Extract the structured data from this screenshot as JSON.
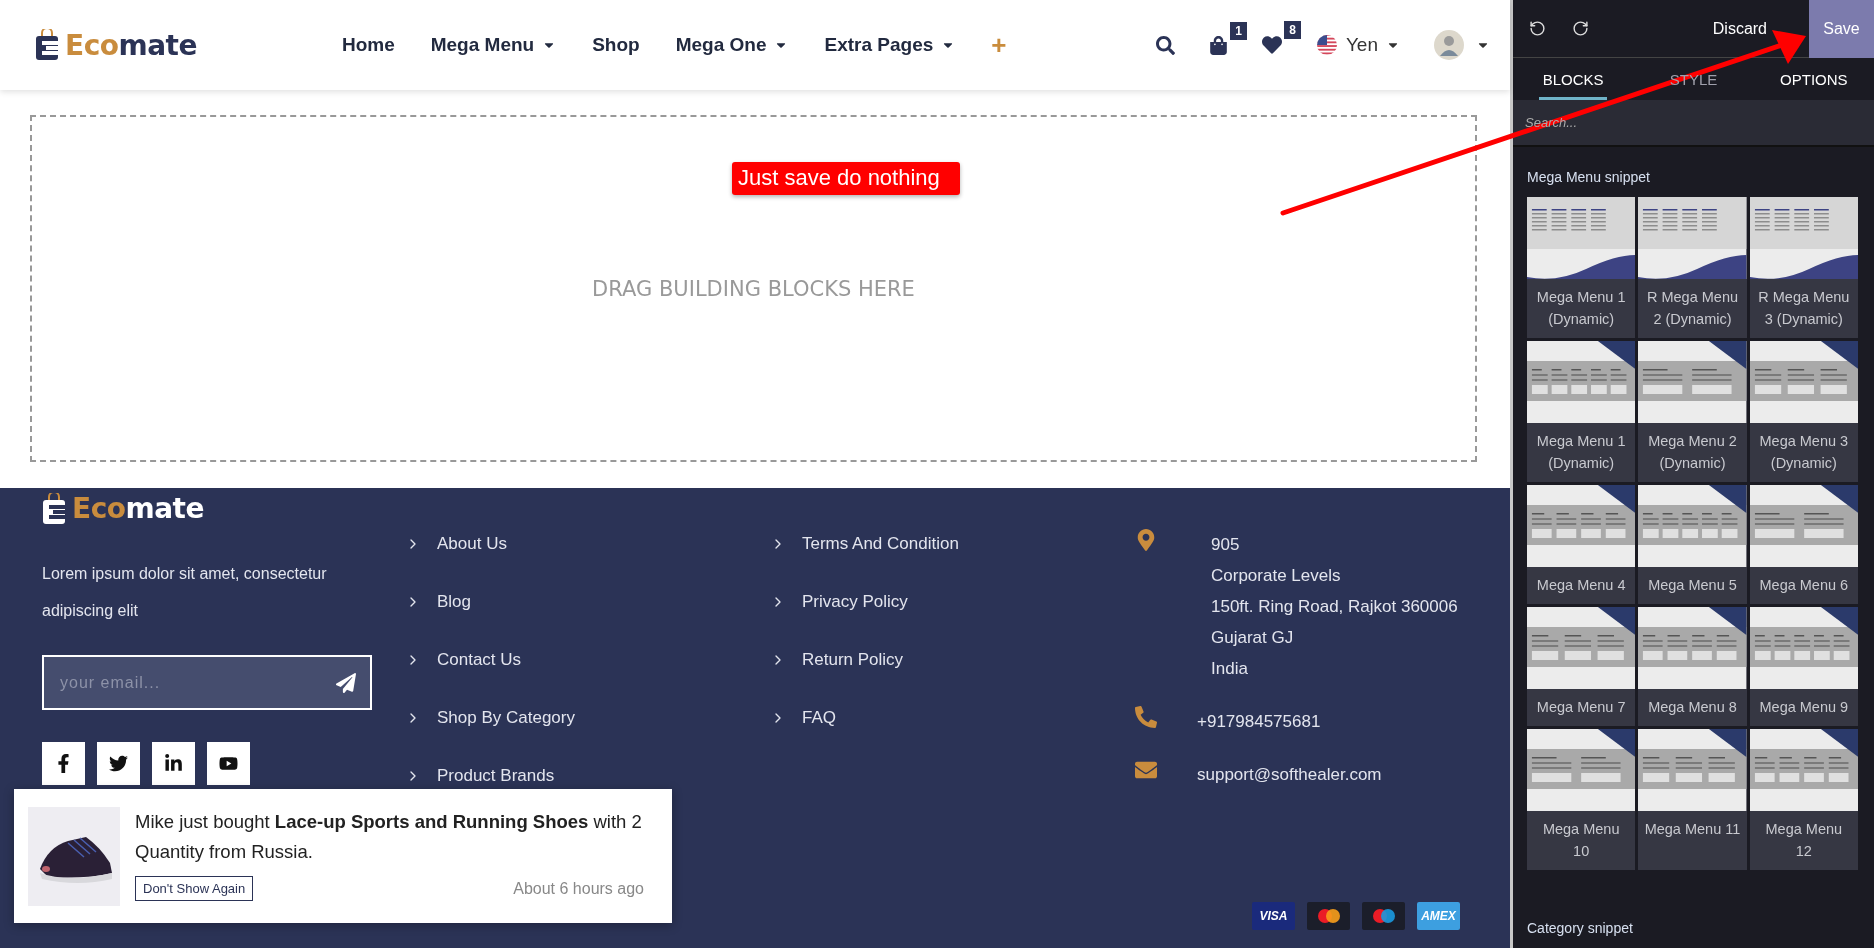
{
  "header": {
    "logo": {
      "accent": "Eco",
      "rest": "mate"
    },
    "nav": [
      {
        "label": "Home",
        "dropdown": false,
        "kind": "link"
      },
      {
        "label": "Mega Menu",
        "dropdown": true,
        "kind": "link"
      },
      {
        "label": "Shop",
        "dropdown": false,
        "kind": "link"
      },
      {
        "label": "Mega One",
        "dropdown": true,
        "kind": "link"
      },
      {
        "label": "Extra Pages",
        "dropdown": true,
        "kind": "link"
      },
      {
        "label": "+",
        "dropdown": false,
        "kind": "plus"
      }
    ],
    "cart_count": "1",
    "wishlist_count": "8",
    "currency": "Yen"
  },
  "editor_canvas": {
    "note": "Just save do nothing",
    "placeholder": "DRAG BUILDING BLOCKS HERE"
  },
  "editor_panel": {
    "discard": "Discard",
    "save": "Save",
    "tabs": [
      {
        "label": "BLOCKS",
        "selected": true,
        "disabled": false
      },
      {
        "label": "STYLE",
        "selected": false,
        "disabled": true
      },
      {
        "label": "OPTIONS",
        "selected": false,
        "disabled": false
      }
    ],
    "search": {
      "placeholder": "Search..."
    },
    "sections": [
      {
        "title": "Mega Menu snippet",
        "items": [
          {
            "label": "Mega Menu 1 (Dynamic)",
            "kind": "wave"
          },
          {
            "label": "R Mega Menu 2 (Dynamic)",
            "kind": "wave"
          },
          {
            "label": "R Mega Menu 3 (Dynamic)",
            "kind": "wave"
          },
          {
            "label": "Mega Menu 1 (Dynamic)",
            "kind": "corner"
          },
          {
            "label": "Mega Menu 2 (Dynamic)",
            "kind": "corner"
          },
          {
            "label": "Mega Menu 3 (Dynamic)",
            "kind": "corner"
          },
          {
            "label": "Mega Menu 4",
            "kind": "corner"
          },
          {
            "label": "Mega Menu 5",
            "kind": "corner"
          },
          {
            "label": "Mega Menu 6",
            "kind": "corner"
          },
          {
            "label": "Mega Menu 7",
            "kind": "corner"
          },
          {
            "label": "Mega Menu 8",
            "kind": "corner"
          },
          {
            "label": "Mega Menu 9",
            "kind": "corner"
          },
          {
            "label": "Mega Menu 10",
            "kind": "corner"
          },
          {
            "label": "Mega Menu 11",
            "kind": "corner"
          },
          {
            "label": "Mega Menu 12",
            "kind": "corner"
          }
        ]
      },
      {
        "title": "Category snippet"
      }
    ]
  },
  "footer": {
    "logo": {
      "accent": "Eco",
      "rest": "mate"
    },
    "about": "Lorem ipsum dolor sit amet, consectetur adipiscing elit",
    "newsletter": {
      "placeholder": "your email..."
    },
    "social": [
      {
        "kind": "facebook"
      },
      {
        "kind": "twitter"
      },
      {
        "kind": "linkedin"
      },
      {
        "kind": "youtube"
      }
    ],
    "links_1": [
      "About Us",
      "Blog",
      "Contact Us",
      "Shop By Category",
      "Product Brands"
    ],
    "links_2": [
      "Terms And Condition",
      "Privacy Policy",
      "Return Policy",
      "FAQ"
    ],
    "contact": [
      {
        "kind": "address",
        "lines": [
          "905",
          "Corporate Levels",
          "150ft. Ring Road, Rajkot 360006",
          "Gujarat GJ",
          "India"
        ]
      },
      {
        "kind": "phone",
        "lines": [
          "+917984575681"
        ]
      },
      {
        "kind": "email",
        "lines": [
          "support@softhealer.com"
        ]
      }
    ],
    "payment_cards": [
      {
        "kind": "visa",
        "label": "VISA"
      },
      {
        "kind": "mastercard"
      },
      {
        "kind": "maestro"
      },
      {
        "kind": "amex",
        "label": "AMEX"
      }
    ]
  },
  "notification": {
    "message": "Mike just bought **Lace-up Sports and Running Shoes** with 2 Quantity from Russia.",
    "button": "Don't Show Again",
    "time": "About 6 hours ago"
  }
}
